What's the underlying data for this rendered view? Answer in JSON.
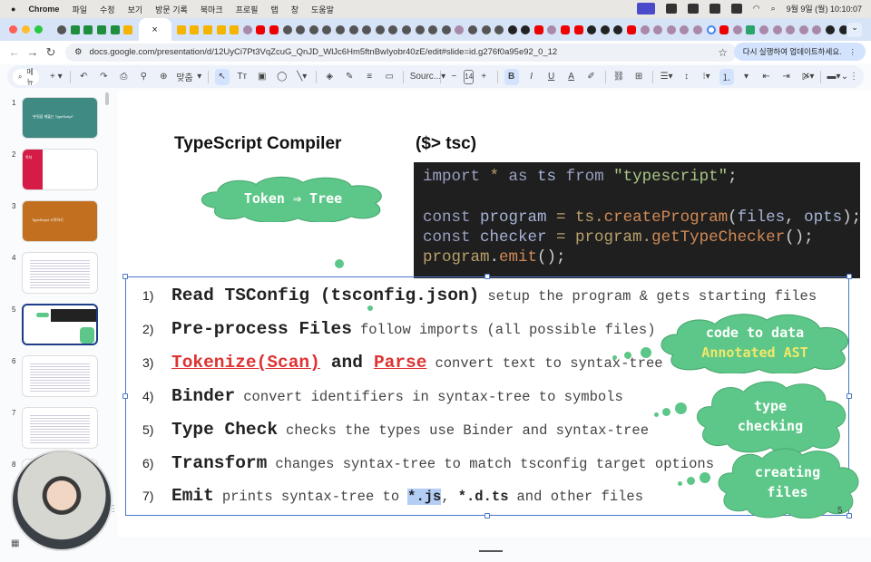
{
  "menubar": {
    "app": "Chrome",
    "items": [
      "파일",
      "수정",
      "보기",
      "방문 기록",
      "북마크",
      "프로필",
      "탭",
      "창",
      "도움말"
    ],
    "clock": "9월 9일 (월) 10:10:07"
  },
  "tabs": {
    "icons_before": [
      "globe",
      "sheet",
      "sheet",
      "sheet",
      "sheet",
      "slide"
    ],
    "active_close": "×",
    "icons_after": [
      "slide",
      "slide",
      "slide",
      "slide",
      "slide",
      "misc",
      "yt",
      "yt",
      "globe",
      "globe",
      "globe",
      "globe",
      "globe",
      "globe",
      "globe",
      "globe",
      "globe",
      "globe",
      "globe",
      "globe",
      "globe",
      "misc",
      "globe",
      "globe",
      "globe",
      "gh",
      "gh",
      "yt",
      "misc",
      "yt",
      "yt",
      "gh",
      "gh",
      "gh",
      "yt",
      "misc",
      "misc",
      "misc",
      "misc",
      "misc",
      "g",
      "yt",
      "misc",
      "v",
      "misc",
      "misc",
      "misc",
      "misc",
      "misc",
      "gh",
      "gh",
      "globe",
      "g",
      "misc",
      "v",
      "v",
      "misc"
    ],
    "new_tab": "+"
  },
  "address": {
    "url": "docs.google.com/presentation/d/12UyCi7Pt3VqZcuG_QnJD_WlJc6Hm5ftnBwIyobr40zE/edit#slide=id.g276f0a95e92_0_12",
    "update_label": "다시 실행하여 업데이트하세요."
  },
  "toolbar": {
    "search_placeholder": "메뉴",
    "zoom": "맞춤",
    "font": "Sourc...",
    "font_size": "14"
  },
  "filmstrip": {
    "slides": [
      {
        "n": "1",
        "title": "\"본질을 꿰뚫는 TypeScript\"",
        "bg": "#3f8a83"
      },
      {
        "n": "2",
        "title": "목차",
        "bg": "#ffffff"
      },
      {
        "n": "3",
        "title": "TypeScript 시작하기",
        "bg": "#c27020"
      },
      {
        "n": "4",
        "title": "",
        "bg": "#ffffff"
      },
      {
        "n": "5",
        "title": "",
        "bg": "#ffffff"
      },
      {
        "n": "6",
        "title": "",
        "bg": "#ffffff"
      },
      {
        "n": "7",
        "title": "",
        "bg": "#ffffff"
      },
      {
        "n": "8",
        "title": "",
        "bg": "#ffffff"
      }
    ],
    "selected": "5"
  },
  "slide": {
    "title": "TypeScript Compiler",
    "subtitle": "($> tsc)",
    "code": [
      [
        [
          "kw",
          "import "
        ],
        [
          "op",
          "* "
        ],
        [
          "kw",
          "as "
        ],
        [
          "id",
          "ts "
        ],
        [
          "kw",
          "from "
        ],
        [
          "str",
          "\"typescript\""
        ],
        [
          "pl",
          ";"
        ]
      ],
      [],
      [
        [
          "kw",
          "const "
        ],
        [
          "id",
          "program "
        ],
        [
          "op",
          "= "
        ],
        [
          "op",
          "ts."
        ],
        [
          "fn",
          "createProgram"
        ],
        [
          "pl",
          "("
        ],
        [
          "id",
          "files"
        ],
        [
          "pl",
          ", "
        ],
        [
          "id",
          "opts"
        ],
        [
          "pl",
          ");"
        ]
      ],
      [
        [
          "kw",
          "const "
        ],
        [
          "id",
          "checker "
        ],
        [
          "op",
          "= "
        ],
        [
          "op",
          "program."
        ],
        [
          "fn",
          "getTypeChecker"
        ],
        [
          "pl",
          "();"
        ]
      ],
      [
        [
          "op",
          "program"
        ],
        [
          "pl",
          "."
        ],
        [
          "fn",
          "emit"
        ],
        [
          "pl",
          "();"
        ]
      ]
    ],
    "steps": [
      {
        "num": "1)",
        "head": "Read TSConfig (tsconfig.json)",
        "desc": "setup the program & gets starting files"
      },
      {
        "num": "2)",
        "head": "Pre-process Files",
        "desc": "follow imports (all possible files)"
      },
      {
        "num": "3)",
        "head_a": "Tokenize(Scan)",
        "head_and": "and",
        "head_b": "Parse",
        "desc": "convert text to syntax-tree"
      },
      {
        "num": "4)",
        "head": "Binder",
        "desc": "convert identifiers in syntax-tree to symbols"
      },
      {
        "num": "5)",
        "head": "Type Check",
        "desc": "checks the types use Binder and syntax-tree"
      },
      {
        "num": "6)",
        "head": "Transform",
        "desc": "changes syntax-tree to match tsconfig target options"
      },
      {
        "num": "7)",
        "head": "Emit",
        "desc_a": "prints syntax-tree to",
        "js": "*.js",
        ",": ",",
        "dts": "*.d.ts",
        "desc_b": "and other files"
      }
    ],
    "clouds": {
      "token_tree": "Token ⇒ Tree",
      "code_to_data": "code to data",
      "annotated_ast": "Annotated AST",
      "type": "type",
      "checking": "checking",
      "creating": "creating",
      "files": "files"
    },
    "page_number": "5",
    "colors": {
      "cloud": "#5cc788",
      "ast": "#f1e86a",
      "red": "#d33333"
    }
  }
}
